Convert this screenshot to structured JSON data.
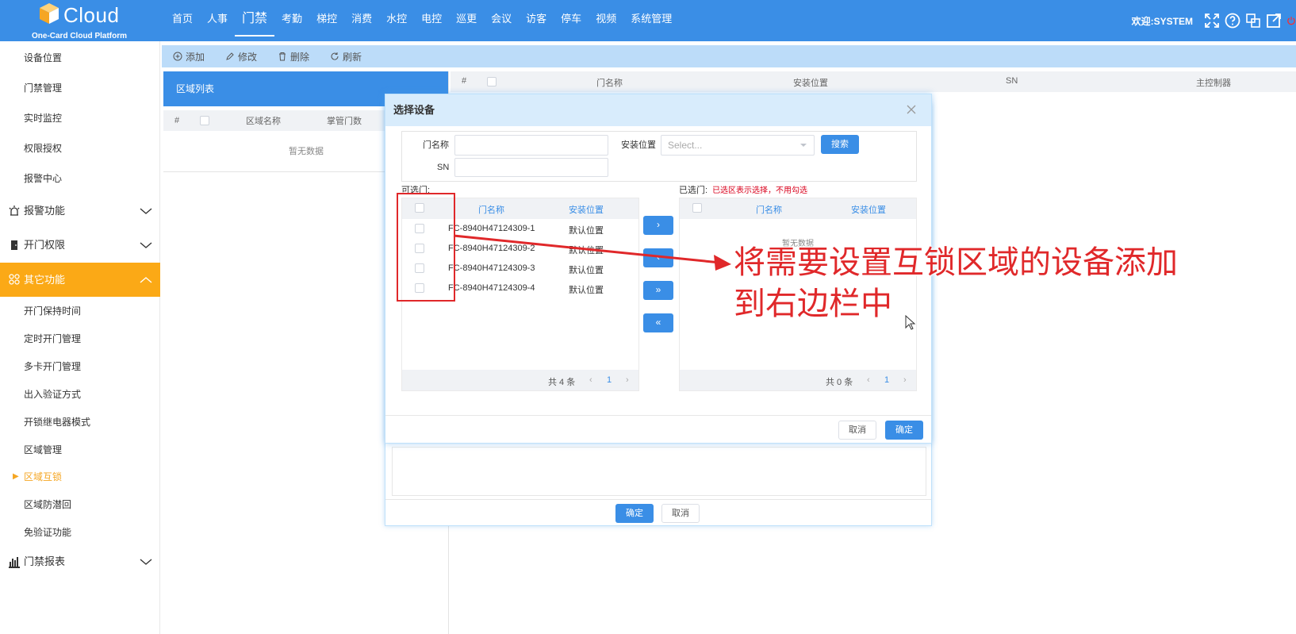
{
  "app": {
    "brand": "Cloud",
    "subtitle": "One-Card Cloud Platform"
  },
  "nav": [
    "首页",
    "人事",
    "门禁",
    "考勤",
    "梯控",
    "消费",
    "水控",
    "电控",
    "巡更",
    "会议",
    "访客",
    "停车",
    "视频",
    "系统管理"
  ],
  "nav_active_index": 2,
  "header": {
    "welcome": "欢迎:SYSTEM"
  },
  "sidebar": {
    "top_items": [
      "设备位置",
      "门禁管理",
      "实时监控",
      "权限授权",
      "报警中心"
    ],
    "groups": [
      {
        "label": "报警功能"
      },
      {
        "label": "开门权限"
      },
      {
        "label": "其它功能"
      }
    ],
    "sub_items": [
      "开门保持时间",
      "定时开门管理",
      "多卡开门管理",
      "出入验证方式",
      "开锁继电器模式",
      "区域管理",
      "区域互锁",
      "区域防潜回",
      "免验证功能"
    ],
    "bottom_group": "门禁报表",
    "accent": "#fba916"
  },
  "toolbar": {
    "add": "添加",
    "edit": "修改",
    "delete": "删除",
    "refresh": "刷新"
  },
  "region_panel": {
    "title": "区域列表",
    "col_index": "#",
    "col_name": "区域名称",
    "col_count": "掌管门数",
    "empty": "暂无数据"
  },
  "main_table": {
    "col_index": "#",
    "col_door": "门名称",
    "col_location": "安装位置",
    "col_sn": "SN",
    "col_controller": "主控制器"
  },
  "dialog": {
    "title": "选择设备",
    "filter": {
      "door_label": "门名称",
      "location_label": "安装位置",
      "location_placeholder": "Select...",
      "sn_label": "SN",
      "search": "搜索"
    },
    "available_label": "可选门:",
    "selected_label": "已选门:",
    "selected_hint": "已选区表示选择，不用勾选",
    "col_door": "门名称",
    "col_location": "安装位置",
    "available_rows": [
      {
        "name": "FC-8940H47124309-1",
        "location": "默认位置"
      },
      {
        "name": "FC-8940H47124309-2",
        "location": "默认位置"
      },
      {
        "name": "FC-8940H47124309-3",
        "location": "默认位置"
      },
      {
        "name": "FC-8940H47124309-4",
        "location": "默认位置"
      }
    ],
    "available_total": "共 4 条",
    "selected_total": "共 0 条",
    "page": "1",
    "selected_empty": "暂无数据",
    "move_right": "›",
    "move_left": "‹",
    "move_all_right": "»",
    "move_all_left": "«",
    "cancel": "取消",
    "ok": "确定"
  },
  "outer_dialog": {
    "ok": "确定",
    "cancel": "取消"
  },
  "annotation": {
    "line1": "将需要设置互锁区域的设备添加",
    "line2": "到右边栏中",
    "color": "#e0282a"
  },
  "colors": {
    "primary": "#3a8ee6",
    "toolbar": "#bcdcf9"
  }
}
